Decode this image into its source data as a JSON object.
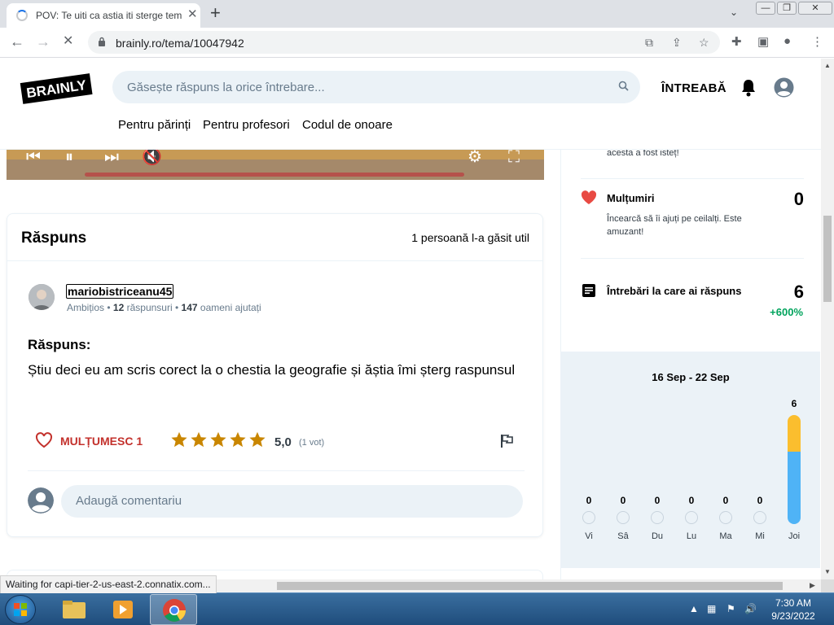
{
  "browser": {
    "tab_title": "POV: Te uiti ca astia iti sterge tem",
    "tab_close": "✕",
    "new_tab": "+",
    "url": "brainly.ro/tema/10047942",
    "back": "←",
    "forward": "→",
    "reload": "✕",
    "window_buttons": {
      "minimize": "—",
      "maximize": "❐",
      "close": "✕"
    }
  },
  "site": {
    "logo_text": "BRAINLY",
    "search_placeholder": "Găsește răspuns la orice întrebare...",
    "ask_label": "ÎNTREABĂ",
    "nav": [
      "Pentru părinți",
      "Pentru profesori",
      "Codul de onoare"
    ]
  },
  "answer_card": {
    "heading": "Răspuns",
    "useful_text": "1 persoană l-a găsit util",
    "author": {
      "name": "mariobistriceanu45",
      "rank": "Ambițios",
      "answers_count": "12",
      "answers_label": "răspunsuri",
      "helped_count": "147",
      "helped_label": "oameni ajutați"
    },
    "answer_label": "Răspuns:",
    "answer_text": "Știu deci eu am scris corect la o chestia la geografie și ăștia îmi șterg raspunsul",
    "thanks_label": "MULȚUMESC 1",
    "rating": 5,
    "rating_text": "5,0",
    "votes_text": "(1 vot)",
    "comment_placeholder": "Adaugă comentariu"
  },
  "sidebar": {
    "top_text": "acesta a fost isteț!",
    "thanks": {
      "label": "Mulțumiri",
      "value": "0",
      "description": "Încearcă să îi ajuți pe ceilalți. Este amuzant!"
    },
    "answered": {
      "label": "Întrebări la care ai răspuns",
      "value": "6",
      "growth": "+600%"
    },
    "week": {
      "range": "16 Sep - 22 Sep",
      "days": [
        {
          "name": "Vi",
          "count": "0"
        },
        {
          "name": "Sâ",
          "count": "0"
        },
        {
          "name": "Du",
          "count": "0"
        },
        {
          "name": "Lu",
          "count": "0"
        },
        {
          "name": "Ma",
          "count": "0"
        },
        {
          "name": "Mi",
          "count": "0"
        },
        {
          "name": "Joi",
          "count": "6"
        }
      ]
    }
  },
  "status_text": "Waiting for capi-tier-2-us-east-2.connatix.com...",
  "taskbar": {
    "time": "7:30 AM",
    "date": "9/23/2022"
  },
  "colors": {
    "brand_dark": "#000000",
    "accent_red": "#c3312c",
    "star_gold": "#c98600",
    "growth_green": "#00a35c",
    "bar_blue": "#4fb3f6",
    "bar_yellow": "#fbbe2e",
    "light_bg": "#ebf2f7"
  },
  "icons": {
    "search": "search-icon",
    "bell": "bell-icon",
    "heart": "heart-icon",
    "star": "star-icon",
    "flag": "flag-icon",
    "list": "list-icon"
  }
}
